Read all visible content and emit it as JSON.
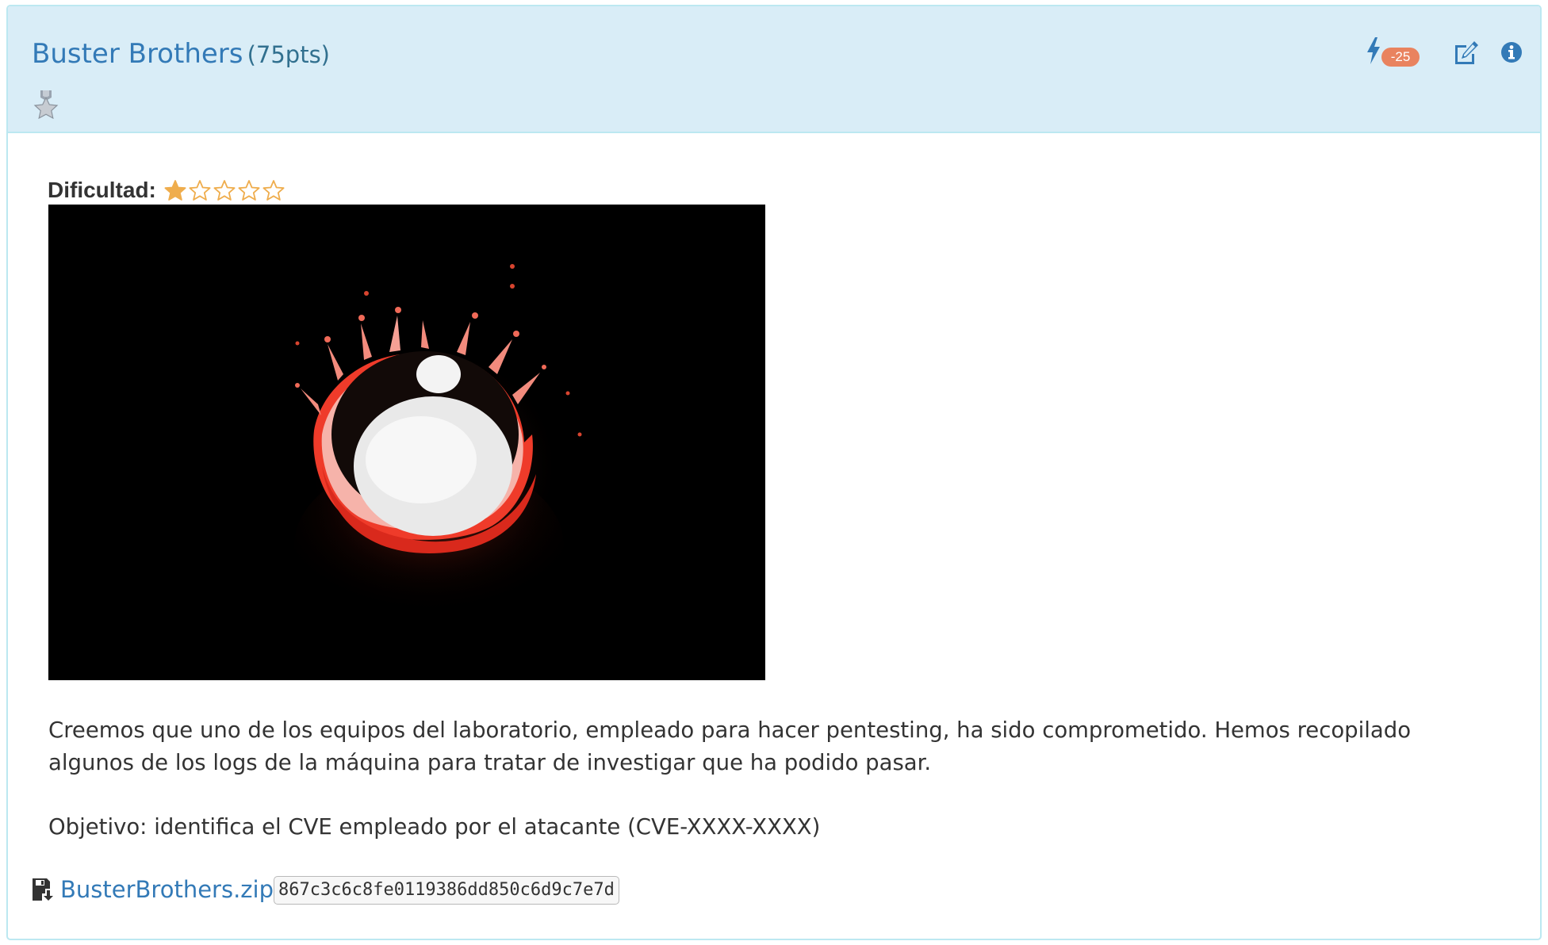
{
  "challenge": {
    "title": "Buster Brothers",
    "points": "(75pts)",
    "medal_icon": "medal-star-icon",
    "actions": {
      "penalty_icon": "bolt-icon",
      "penalty_badge": "-25",
      "edit_icon": "edit-icon",
      "info_icon": "info-icon"
    },
    "difficulty": {
      "label": "Dificultad:",
      "rating": 1,
      "max": 5,
      "star_color": "#efad4d"
    },
    "description": [
      "Creemos que uno de los equipos del laboratorio, empleado para hacer pentesting, ha sido comprometido. Hemos recopilado algunos de los logs de la máquina para tratar de investigar que ha podido pasar.",
      "Objetivo: identifica el CVE empleado por el atacante (CVE-XXXX-XXXX)"
    ],
    "file": {
      "icon": "download-file-icon",
      "name": "BusterBrothers.zip",
      "hash": "867c3c6c8fe0119386dd850c6d9c7e7d"
    }
  },
  "colors": {
    "heading_bg": "#d9edf7",
    "heading_border": "#bce8f1",
    "link": "#337ab7",
    "badge": "#e9835f"
  }
}
